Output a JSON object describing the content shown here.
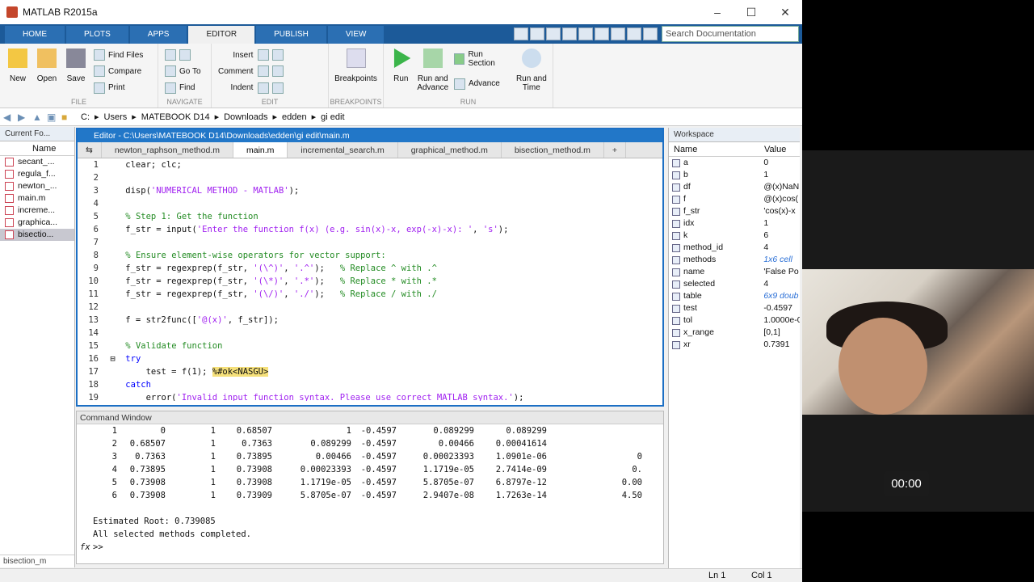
{
  "window": {
    "title": "MATLAB R2015a"
  },
  "ribbon_tabs": [
    "HOME",
    "PLOTS",
    "APPS",
    "EDITOR",
    "PUBLISH",
    "VIEW"
  ],
  "search": {
    "placeholder": "Search Documentation"
  },
  "ribbon": {
    "file": {
      "label": "FILE",
      "new": "New",
      "open": "Open",
      "save": "Save",
      "find_files": "Find Files",
      "compare": "Compare",
      "print": "Print"
    },
    "navigate": {
      "label": "NAVIGATE",
      "go_to": "Go To",
      "find": "Find"
    },
    "edit": {
      "label": "EDIT",
      "insert": "Insert",
      "comment": "Comment",
      "indent": "Indent"
    },
    "breakpoints": {
      "label": "BREAKPOINTS",
      "breakpoints": "Breakpoints"
    },
    "run": {
      "label": "RUN",
      "run": "Run",
      "run_and_advance": "Run and Advance",
      "run_section": "Run Section",
      "advance": "Advance",
      "run_and_time": "Run and Time"
    }
  },
  "path": [
    "C:",
    "Users",
    "MATEBOOK D14",
    "Downloads",
    "edden",
    "gi edit"
  ],
  "current_folder": {
    "title": "Current Fo...",
    "col": "Name",
    "files": [
      "secant_...",
      "regula_f...",
      "newton_...",
      "main.m",
      "increme...",
      "graphica...",
      "bisectio..."
    ],
    "footer": "bisection_m"
  },
  "editor": {
    "title": "Editor - C:\\Users\\MATEBOOK D14\\Downloads\\edden\\gi edit\\main.m",
    "tabs": [
      "newton_raphson_method.m",
      "main.m",
      "incremental_search.m",
      "graphical_method.m",
      "bisection_method.m"
    ],
    "lines": [
      "1",
      "2",
      "3",
      "4",
      "5",
      "6",
      "7",
      "8",
      "9",
      "10",
      "11",
      "12",
      "13",
      "14",
      "15",
      "16",
      "17",
      "18",
      "19"
    ]
  },
  "command": {
    "title": "Command Window",
    "rows": [
      [
        "1",
        "0",
        "1",
        "0.68507",
        "1",
        "-0.4597",
        "0.089299",
        "0.089299",
        ""
      ],
      [
        "2",
        "0.68507",
        "1",
        "0.7363",
        "0.089299",
        "-0.4597",
        "0.00466",
        "0.00041614",
        ""
      ],
      [
        "3",
        "0.7363",
        "1",
        "0.73895",
        "0.00466",
        "-0.4597",
        "0.00023393",
        "1.0901e-06",
        "0"
      ],
      [
        "4",
        "0.73895",
        "1",
        "0.73908",
        "0.00023393",
        "-0.4597",
        "1.1719e-05",
        "2.7414e-09",
        "0."
      ],
      [
        "5",
        "0.73908",
        "1",
        "0.73908",
        "1.1719e-05",
        "-0.4597",
        "5.8705e-07",
        "6.8797e-12",
        "0.00"
      ],
      [
        "6",
        "0.73908",
        "1",
        "0.73909",
        "5.8705e-07",
        "-0.4597",
        "2.9407e-08",
        "1.7263e-14",
        "4.50"
      ]
    ],
    "estimated": "Estimated Root: 0.739085",
    "completed": "All selected methods completed.",
    "prompt": ">>"
  },
  "workspace": {
    "title": "Workspace",
    "cols": [
      "Name",
      "Value"
    ],
    "vars": [
      [
        "a",
        "0"
      ],
      [
        "b",
        "1"
      ],
      [
        "df",
        "@(x)NaN"
      ],
      [
        "f",
        "@(x)cos("
      ],
      [
        "f_str",
        "'cos(x)-x"
      ],
      [
        "idx",
        "1"
      ],
      [
        "k",
        "6"
      ],
      [
        "method_id",
        "4"
      ],
      [
        "methods",
        "1x6 cell"
      ],
      [
        "name",
        "'False Po"
      ],
      [
        "selected",
        "4"
      ],
      [
        "table",
        "6x9 doub"
      ],
      [
        "test",
        "-0.4597"
      ],
      [
        "tol",
        "1.0000e-0"
      ],
      [
        "x_range",
        "[0,1]"
      ],
      [
        "xr",
        "0.7391"
      ]
    ]
  },
  "statusbar": {
    "ln": "Ln  1",
    "col": "Col  1"
  },
  "video": {
    "timer": "00:00"
  }
}
